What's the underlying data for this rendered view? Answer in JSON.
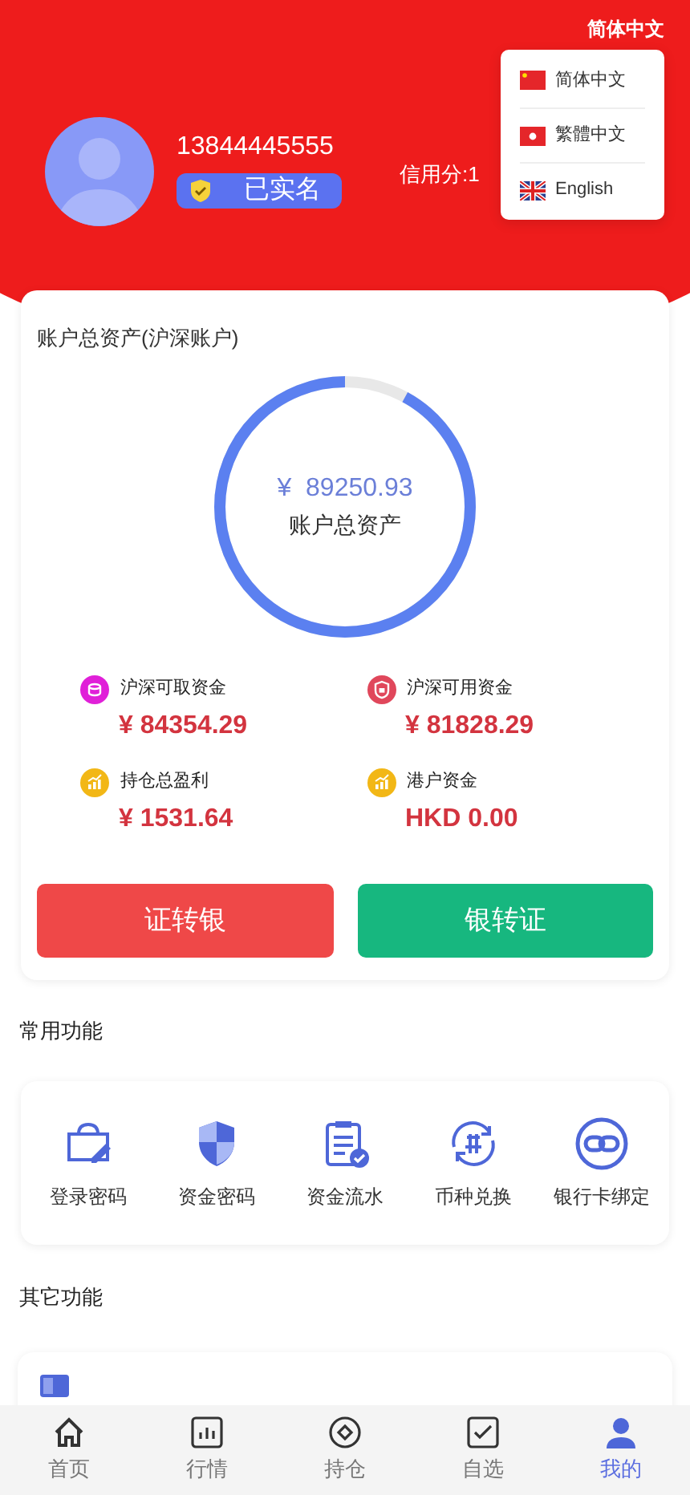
{
  "language": {
    "current": "简体中文",
    "options": [
      {
        "label": "简体中文",
        "kind": "cn"
      },
      {
        "label": "繁體中文",
        "kind": "hk"
      },
      {
        "label": "English",
        "kind": "uk"
      }
    ]
  },
  "profile": {
    "phone": "13844445555",
    "verified_label": "已实名",
    "credit": "信用分:1"
  },
  "assets": {
    "title": "账户总资产(沪深账户)",
    "total": "¥  89250.93",
    "total_label": "账户总资产",
    "level": 0.92,
    "items": [
      {
        "label": "沪深可取资金",
        "value": "¥ 84354.29",
        "kind": "coins",
        "color": "#e020d8"
      },
      {
        "label": "沪深可用资金",
        "value": "¥ 81828.29",
        "kind": "lock",
        "color": "#e0475b"
      },
      {
        "label": "持仓总盈利",
        "value": "¥ 1531.64",
        "kind": "chart",
        "color": "#f2b716"
      },
      {
        "label": "港户资金",
        "value": "HKD 0.00",
        "kind": "chart",
        "color": "#f2b716"
      }
    ],
    "buttons": [
      {
        "label": "证转银",
        "kind": "out"
      },
      {
        "label": "银转证",
        "kind": "in"
      }
    ]
  },
  "common": {
    "title": "常用功能",
    "items": [
      {
        "label": "登录密码",
        "kind": "bag"
      },
      {
        "label": "资金密码",
        "kind": "shield"
      },
      {
        "label": "资金流水",
        "kind": "clipboard"
      },
      {
        "label": "币种兑换",
        "kind": "exchange"
      },
      {
        "label": "银行卡绑定",
        "kind": "link"
      }
    ]
  },
  "other": {
    "title": "其它功能"
  },
  "tabbar": [
    {
      "label": "首页",
      "kind": "home",
      "selected": false
    },
    {
      "label": "行情",
      "kind": "bars",
      "selected": false
    },
    {
      "label": "持仓",
      "kind": "circle",
      "selected": false
    },
    {
      "label": "自选",
      "kind": "check",
      "selected": false
    },
    {
      "label": "我的",
      "kind": "user",
      "selected": true
    }
  ]
}
